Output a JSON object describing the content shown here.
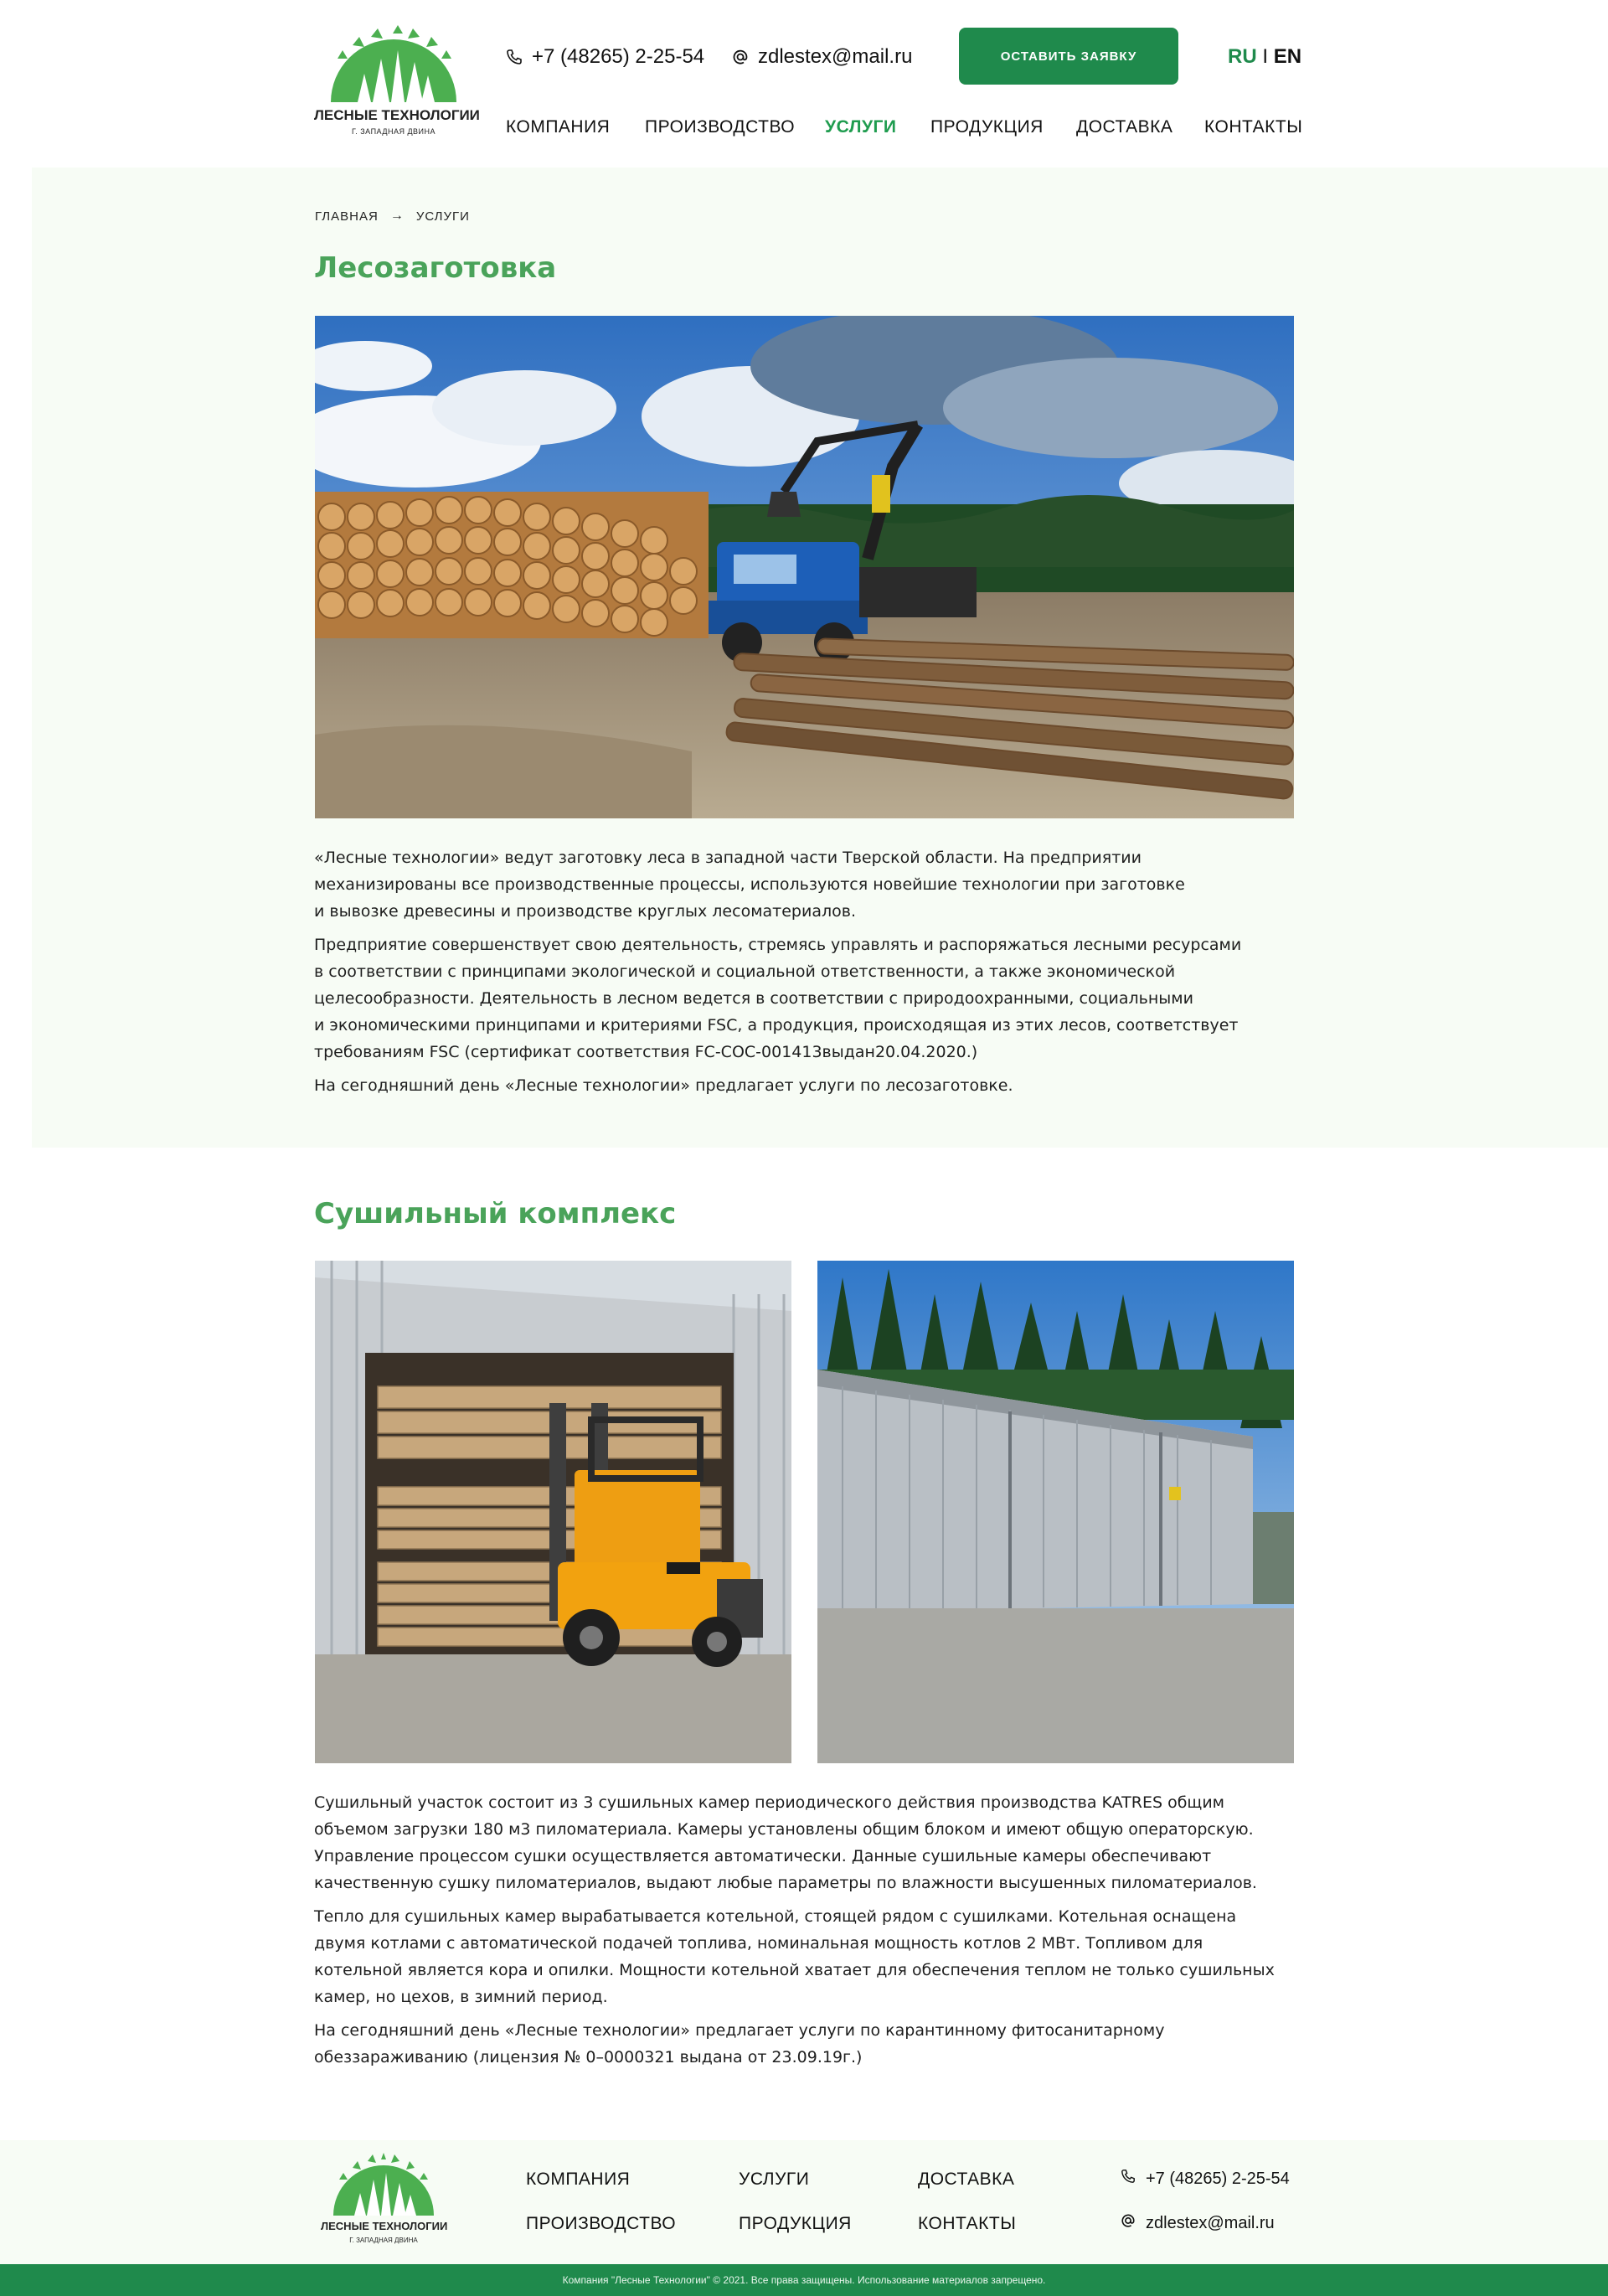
{
  "brand": {
    "logo_title": "ЛЕСНЫЕ ТЕХНОЛОГИИ",
    "logo_subtitle": "Г. ЗАПАДНАЯ ДВИНА",
    "green": "#1f8a4c",
    "title_green": "#4aa35a"
  },
  "header": {
    "phone": "+7 (48265) 2-25-54",
    "email": "zdlestex@mail.ru",
    "cta_label": "ОСТАВИТЬ ЗАЯВКУ",
    "lang_ru": "RU",
    "lang_sep": "I",
    "lang_en": "EN",
    "nav": [
      {
        "label": "КОМПАНИЯ"
      },
      {
        "label": "ПРОИЗВОДСТВО"
      },
      {
        "label": "УСЛУГИ",
        "active": true
      },
      {
        "label": "ПРОДУКЦИЯ"
      },
      {
        "label": "ДОСТАВКА"
      },
      {
        "label": "КОНТАКТЫ"
      }
    ]
  },
  "breadcrumb": {
    "home": "ГЛАВНАЯ",
    "arrow": "→",
    "current": "УСЛУГИ"
  },
  "logging": {
    "title": "Лесозаготовка",
    "paragraphs": [
      "«Лесные технологии» ведут заготовку леса в западной части Тверской области. На предприятии\nмеханизированы все производственные процессы, используются новейшие технологии при заготовке\nи вывозке древесины и производстве круглых лесоматериалов.",
      "Предприятие совершенствует свою деятельность, стремясь управлять и распоряжаться лесными ресурсами\nв соответствии с принципами экологической и социальной ответственности, а также экономической\nцелесообразности.  Деятельность в лесном ведется в соответствии с природоохранными, социальными\nи экономическими принципами и критериями FSC, а продукция, происходящая из этих лесов, соответствует\nтребованиям FSC (сертификат соответствия FC-COC-001413выдан20.04.2020.)",
      "На сегодняшний день «Лесные технологии» предлагает услуги по лесозаготовке."
    ]
  },
  "drying": {
    "title": "Сушильный комплекс",
    "paragraphs": [
      "Сушильный участок состоит из 3 сушильных камер периодического действия производства KATRES общим\nобъемом загрузки 180 м3 пиломатериала. Камеры установлены общим блоком и имеют общую операторскую.\nУправление процессом сушки осуществляется автоматически. Данные сушильные камеры обеспечивают\nкачественную сушку пиломатериалов, выдают любые параметры по влажности высушенных пиломатериалов.",
      "Тепло для сушильных камер вырабатывается котельной, стоящей рядом с сушилками. Котельная оснащена\nдвумя котлами с автоматической подачей топлива, номинальная мощность котлов 2 МВт. Топливом для\nкотельной является кора и опилки. Мощности котельной хватает для обеспечения теплом не только сушильных\nкамер, но цехов, в зимний период.",
      "На сегодняшний день «Лесные технологии» предлагает услуги по карантинному фитосанитарному\nобеззараживанию (лицензия № 0–0000321 выдана от 23.09.19г.)"
    ]
  },
  "footer": {
    "links": [
      "КОМПАНИЯ",
      "ПРОИЗВОДСТВО",
      "УСЛУГИ",
      "ПРОДУКЦИЯ",
      "ДОСТАВКА",
      "КОНТАКТЫ"
    ],
    "phone": "+7 (48265) 2-25-54",
    "email": "zdlestex@mail.ru",
    "copyright": "Компания \"Лесные Технологии\" © 2021. Все права защищены. Использование материалов запрещено."
  }
}
